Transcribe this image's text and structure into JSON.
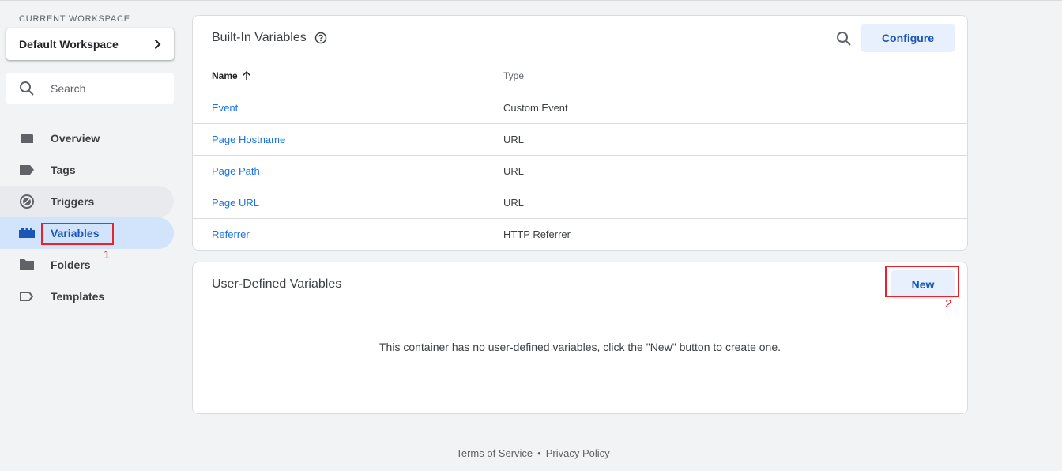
{
  "workspace": {
    "caption": "CURRENT WORKSPACE",
    "name": "Default Workspace"
  },
  "search": {
    "placeholder": "Search"
  },
  "nav": {
    "items": [
      {
        "label": "Overview",
        "icon": "overview-icon"
      },
      {
        "label": "Tags",
        "icon": "tag-icon"
      },
      {
        "label": "Triggers",
        "icon": "trigger-icon"
      },
      {
        "label": "Variables",
        "icon": "variables-icon"
      },
      {
        "label": "Folders",
        "icon": "folder-icon"
      },
      {
        "label": "Templates",
        "icon": "template-icon"
      }
    ],
    "active": "Variables",
    "hovered": "Triggers"
  },
  "builtin": {
    "title": "Built-In Variables",
    "configure_label": "Configure",
    "columns": {
      "name": "Name",
      "type": "Type"
    },
    "rows": [
      {
        "name": "Event",
        "type": "Custom Event"
      },
      {
        "name": "Page Hostname",
        "type": "URL"
      },
      {
        "name": "Page Path",
        "type": "URL"
      },
      {
        "name": "Page URL",
        "type": "URL"
      },
      {
        "name": "Referrer",
        "type": "HTTP Referrer"
      }
    ]
  },
  "user_defined": {
    "title": "User-Defined Variables",
    "new_label": "New",
    "empty_message": "This container has no user-defined variables, click the \"New\" button to create one."
  },
  "annotations": {
    "one": "1",
    "two": "2",
    "color": "#e8232a"
  },
  "footer": {
    "terms": "Terms of Service",
    "separator": "•",
    "privacy": "Privacy Policy"
  },
  "colors": {
    "accent": "#1a73e8",
    "active_nav_bg": "#d2e3fc",
    "button_bg": "#e8f0fe"
  }
}
